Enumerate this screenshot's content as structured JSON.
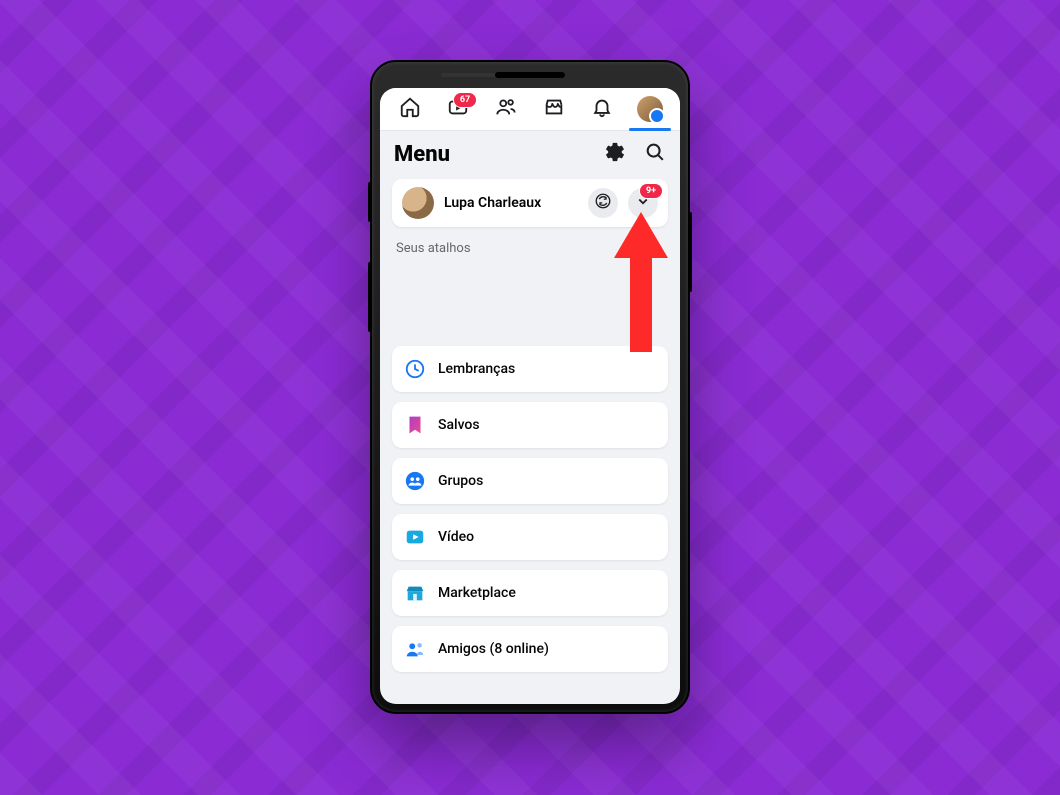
{
  "topbar": {
    "watch_badge": "67"
  },
  "header": {
    "title": "Menu"
  },
  "profile": {
    "name": "Lupa Charleaux",
    "expand_badge": "9+"
  },
  "shortcuts": {
    "label": "Seus atalhos"
  },
  "menu": {
    "items": [
      {
        "key": "memories",
        "label": "Lembranças"
      },
      {
        "key": "saved",
        "label": "Salvos"
      },
      {
        "key": "groups",
        "label": "Grupos"
      },
      {
        "key": "video",
        "label": "Vídeo"
      },
      {
        "key": "marketplace",
        "label": "Marketplace"
      },
      {
        "key": "friends",
        "label": "Amigos (8 online)"
      }
    ]
  },
  "colors": {
    "accent": "#1877f2",
    "badge": "#f02849",
    "annotation_arrow": "#fe2a2a",
    "background": "#8a2bd4"
  }
}
